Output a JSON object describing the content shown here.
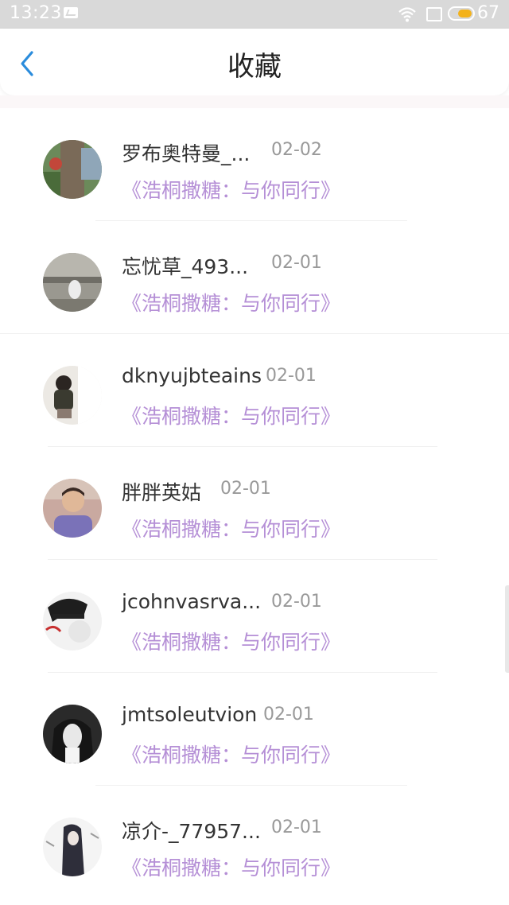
{
  "status_bar": {
    "time": "13:23",
    "battery_percent": "67",
    "battery_level": 0.67,
    "battery_color": "#f3b21b"
  },
  "header": {
    "title": "收藏",
    "back_icon": "chevron-left-icon",
    "accent": "#2a8cdc"
  },
  "items": [
    {
      "name": "罗布奥特曼_...",
      "date": "02-02",
      "title": "《浩桐撒糖：与你同行》"
    },
    {
      "name": "忘忧草_493...",
      "date": "02-01",
      "title": "《浩桐撒糖：与你同行》"
    },
    {
      "name": "dknyujbteains",
      "date": "02-01",
      "title": "《浩桐撒糖：与你同行》"
    },
    {
      "name": "胖胖英姑",
      "date": "02-01",
      "title": "《浩桐撒糖：与你同行》"
    },
    {
      "name": "jcohnvasrva...",
      "date": "02-01",
      "title": "《浩桐撒糖：与你同行》"
    },
    {
      "name": "jmtsoleutvion",
      "date": "02-01",
      "title": "《浩桐撒糖：与你同行》"
    },
    {
      "name": "凉介-_77957...",
      "date": "02-01",
      "title": "《浩桐撒糖：与你同行》"
    }
  ],
  "colors": {
    "title_link": "#b58fd6",
    "date": "#999999",
    "name": "#333333"
  }
}
